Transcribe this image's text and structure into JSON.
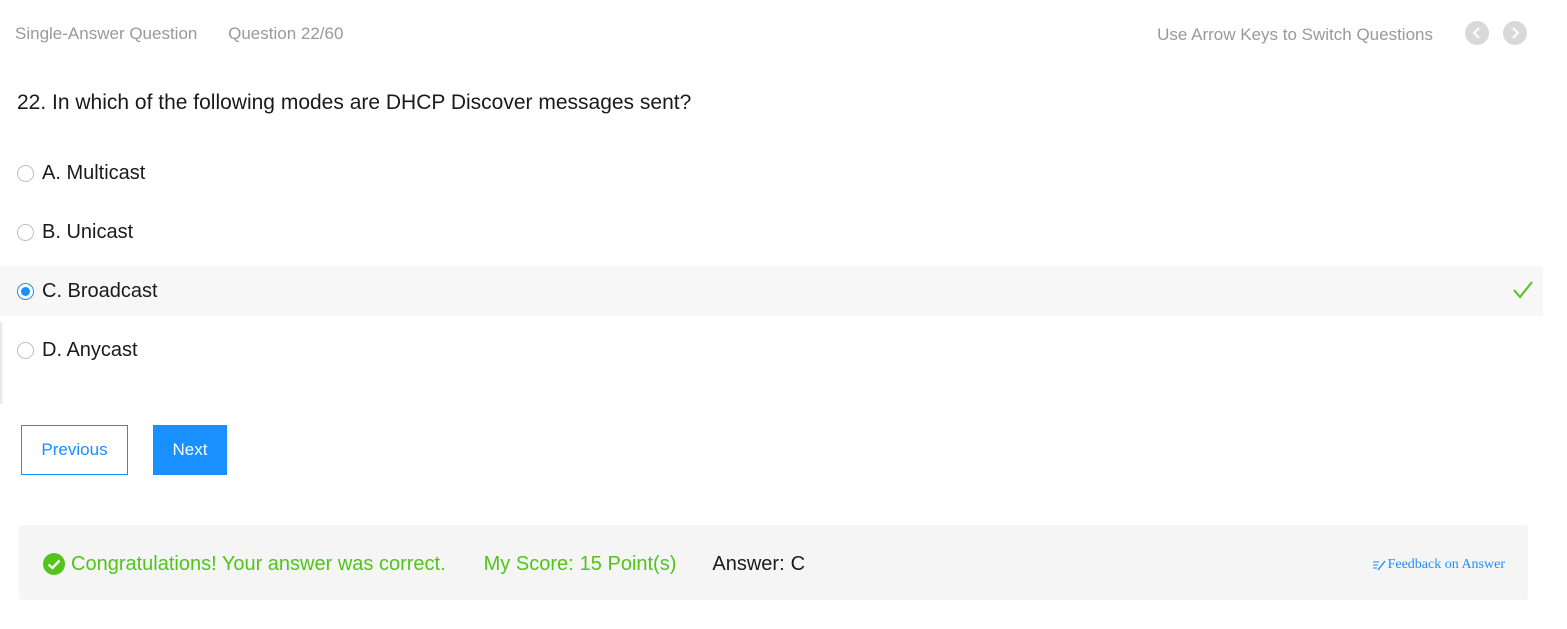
{
  "header": {
    "question_type": "Single-Answer Question",
    "question_counter": "Question 22/60",
    "hint": "Use Arrow Keys to Switch Questions"
  },
  "question": {
    "text": "22. In which of the following modes are DHCP Discover messages sent?"
  },
  "options": [
    {
      "label": "A. Multicast",
      "selected": false
    },
    {
      "label": "B. Unicast",
      "selected": false
    },
    {
      "label": "C. Broadcast",
      "selected": true,
      "correct": true
    },
    {
      "label": "D. Anycast",
      "selected": false
    }
  ],
  "buttons": {
    "previous": "Previous",
    "next": "Next"
  },
  "result": {
    "message": "Congratulations! Your answer was correct.",
    "score_label": "My Score:",
    "score_value": "15 Point(s)",
    "answer_label": "Answer:",
    "answer_value": "C",
    "feedback_link": "Feedback on Answer"
  },
  "colors": {
    "accent": "#1890ff",
    "success": "#52c41a",
    "muted_text": "#999999"
  }
}
